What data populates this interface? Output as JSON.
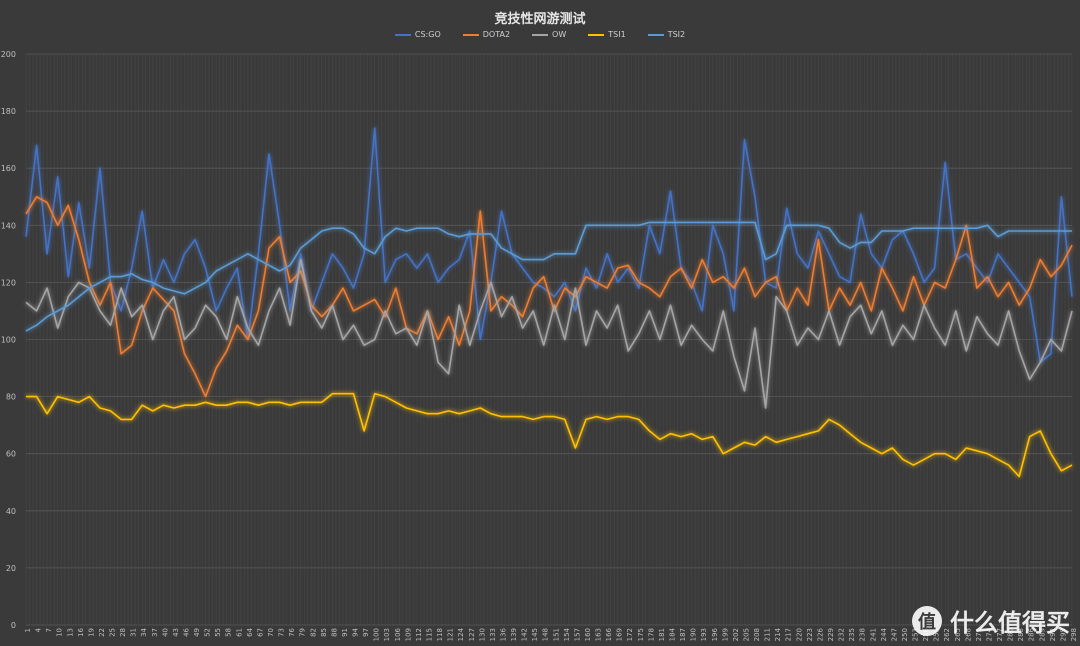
{
  "chart_data": {
    "type": "line",
    "title": "竞技性网游测试",
    "xlabel": "",
    "ylabel": "",
    "ylim": [
      0,
      200
    ],
    "yticks": [
      0,
      20,
      40,
      60,
      80,
      100,
      120,
      140,
      160,
      180,
      200
    ],
    "x_tick_labels": [
      1,
      4,
      7,
      10,
      13,
      16,
      19,
      22,
      25,
      28,
      31,
      34,
      37,
      40,
      43,
      46,
      49,
      52,
      55,
      58,
      61,
      64,
      67,
      70,
      73,
      76,
      79,
      82,
      85,
      88,
      91,
      94,
      97,
      100,
      103,
      106,
      109,
      112,
      115,
      118,
      121,
      124,
      127,
      130,
      133,
      136,
      139,
      142,
      145,
      148,
      151,
      154,
      157,
      160,
      163,
      166,
      169,
      172,
      175,
      178,
      181,
      184,
      187,
      190,
      193,
      196,
      199,
      202,
      205,
      208,
      211,
      214,
      217,
      220,
      223,
      226,
      229,
      232,
      235,
      238,
      241,
      244,
      247,
      250,
      253,
      256,
      259,
      262,
      265,
      268,
      271,
      274,
      277,
      280,
      283,
      286,
      289,
      292,
      295,
      298
    ],
    "grid": true,
    "legend_position": "top",
    "series": [
      {
        "name": "CS:GO",
        "color": "#4472c4",
        "x": [
          1,
          4,
          7,
          10,
          13,
          16,
          19,
          22,
          25,
          28,
          31,
          34,
          37,
          40,
          43,
          46,
          49,
          52,
          55,
          58,
          61,
          64,
          67,
          70,
          73,
          76,
          79,
          82,
          85,
          88,
          91,
          94,
          97,
          100,
          103,
          106,
          109,
          112,
          115,
          118,
          121,
          124,
          127,
          130,
          133,
          136,
          139,
          142,
          145,
          148,
          151,
          154,
          157,
          160,
          163,
          166,
          169,
          172,
          175,
          178,
          181,
          184,
          187,
          190,
          193,
          196,
          199,
          202,
          205,
          208,
          211,
          214,
          217,
          220,
          223,
          226,
          229,
          232,
          235,
          238,
          241,
          244,
          247,
          250,
          253,
          256,
          259,
          262,
          265,
          268,
          271,
          274,
          277,
          280,
          283,
          286,
          289,
          292,
          295,
          298
        ],
        "values": [
          136,
          168,
          130,
          157,
          122,
          148,
          125,
          160,
          120,
          110,
          125,
          145,
          118,
          128,
          120,
          130,
          135,
          125,
          110,
          118,
          125,
          100,
          130,
          165,
          140,
          110,
          130,
          110,
          120,
          130,
          125,
          118,
          130,
          174,
          120,
          128,
          130,
          125,
          130,
          120,
          125,
          128,
          138,
          100,
          120,
          145,
          130,
          125,
          120,
          118,
          115,
          120,
          110,
          125,
          118,
          130,
          120,
          125,
          118,
          140,
          130,
          152,
          125,
          120,
          110,
          140,
          130,
          110,
          170,
          150,
          120,
          118,
          146,
          130,
          125,
          138,
          130,
          122,
          120,
          144,
          130,
          125,
          135,
          138,
          130,
          120,
          125,
          162,
          128,
          130,
          125,
          120,
          130,
          125,
          120,
          115,
          92,
          95,
          150,
          115
        ]
      },
      {
        "name": "DOTA2",
        "color": "#ed7d31",
        "x": [
          1,
          4,
          7,
          10,
          13,
          16,
          19,
          22,
          25,
          28,
          31,
          34,
          37,
          40,
          43,
          46,
          49,
          52,
          55,
          58,
          61,
          64,
          67,
          70,
          73,
          76,
          79,
          82,
          85,
          88,
          91,
          94,
          97,
          100,
          103,
          106,
          109,
          112,
          115,
          118,
          121,
          124,
          127,
          130,
          133,
          136,
          139,
          142,
          145,
          148,
          151,
          154,
          157,
          160,
          163,
          166,
          169,
          172,
          175,
          178,
          181,
          184,
          187,
          190,
          193,
          196,
          199,
          202,
          205,
          208,
          211,
          214,
          217,
          220,
          223,
          226,
          229,
          232,
          235,
          238,
          241,
          244,
          247,
          250,
          253,
          256,
          259,
          262,
          265,
          268,
          271,
          274,
          277,
          280,
          283,
          286,
          289,
          292,
          295,
          298
        ],
        "values": [
          144,
          150,
          148,
          140,
          147,
          135,
          120,
          112,
          120,
          95,
          98,
          110,
          118,
          114,
          110,
          95,
          88,
          80,
          90,
          96,
          105,
          100,
          110,
          132,
          136,
          120,
          124,
          112,
          108,
          112,
          118,
          110,
          112,
          114,
          108,
          118,
          104,
          102,
          110,
          100,
          108,
          98,
          110,
          145,
          110,
          115,
          112,
          108,
          118,
          122,
          110,
          118,
          115,
          122,
          120,
          118,
          125,
          126,
          120,
          118,
          115,
          122,
          125,
          118,
          128,
          120,
          122,
          118,
          125,
          115,
          120,
          122,
          110,
          118,
          112,
          135,
          110,
          118,
          112,
          120,
          110,
          125,
          118,
          110,
          122,
          112,
          120,
          118,
          128,
          140,
          118,
          122,
          115,
          120,
          112,
          118,
          128,
          122,
          126,
          133
        ]
      },
      {
        "name": "OW",
        "color": "#a5a5a5",
        "x": [
          1,
          4,
          7,
          10,
          13,
          16,
          19,
          22,
          25,
          28,
          31,
          34,
          37,
          40,
          43,
          46,
          49,
          52,
          55,
          58,
          61,
          64,
          67,
          70,
          73,
          76,
          79,
          82,
          85,
          88,
          91,
          94,
          97,
          100,
          103,
          106,
          109,
          112,
          115,
          118,
          121,
          124,
          127,
          130,
          133,
          136,
          139,
          142,
          145,
          148,
          151,
          154,
          157,
          160,
          163,
          166,
          169,
          172,
          175,
          178,
          181,
          184,
          187,
          190,
          193,
          196,
          199,
          202,
          205,
          208,
          211,
          214,
          217,
          220,
          223,
          226,
          229,
          232,
          235,
          238,
          241,
          244,
          247,
          250,
          253,
          256,
          259,
          262,
          265,
          268,
          271,
          274,
          277,
          280,
          283,
          286,
          289,
          292,
          295,
          298
        ],
        "values": [
          113,
          110,
          118,
          104,
          115,
          120,
          118,
          110,
          105,
          118,
          108,
          112,
          100,
          110,
          115,
          100,
          104,
          112,
          108,
          100,
          115,
          104,
          98,
          110,
          118,
          105,
          128,
          110,
          104,
          112,
          100,
          105,
          98,
          100,
          110,
          102,
          104,
          98,
          110,
          92,
          88,
          112,
          98,
          110,
          120,
          108,
          115,
          104,
          110,
          98,
          112,
          100,
          118,
          98,
          110,
          104,
          112,
          96,
          102,
          110,
          100,
          112,
          98,
          105,
          100,
          96,
          110,
          94,
          82,
          104,
          76,
          115,
          110,
          98,
          104,
          100,
          110,
          98,
          108,
          112,
          102,
          110,
          98,
          105,
          100,
          112,
          104,
          98,
          110,
          96,
          108,
          102,
          98,
          110,
          96,
          86,
          92,
          100,
          96,
          110
        ]
      },
      {
        "name": "TSI1",
        "color": "#ffc000",
        "x": [
          1,
          4,
          7,
          10,
          13,
          16,
          19,
          22,
          25,
          28,
          31,
          34,
          37,
          40,
          43,
          46,
          49,
          52,
          55,
          58,
          61,
          64,
          67,
          70,
          73,
          76,
          79,
          82,
          85,
          88,
          91,
          94,
          97,
          100,
          103,
          106,
          109,
          112,
          115,
          118,
          121,
          124,
          127,
          130,
          133,
          136,
          139,
          142,
          145,
          148,
          151,
          154,
          157,
          160,
          163,
          166,
          169,
          172,
          175,
          178,
          181,
          184,
          187,
          190,
          193,
          196,
          199,
          202,
          205,
          208,
          211,
          214,
          217,
          220,
          223,
          226,
          229,
          232,
          235,
          238,
          241,
          244,
          247,
          250,
          253,
          256,
          259,
          262,
          265,
          268,
          271,
          274,
          277,
          280,
          283,
          286,
          289,
          292,
          295,
          298
        ],
        "values": [
          80,
          80,
          74,
          80,
          79,
          78,
          80,
          76,
          75,
          72,
          72,
          77,
          75,
          77,
          76,
          77,
          77,
          78,
          77,
          77,
          78,
          78,
          77,
          78,
          78,
          77,
          78,
          78,
          78,
          81,
          81,
          81,
          68,
          81,
          80,
          78,
          76,
          75,
          74,
          74,
          75,
          74,
          75,
          76,
          74,
          73,
          73,
          73,
          72,
          73,
          73,
          72,
          62,
          72,
          73,
          72,
          73,
          73,
          72,
          68,
          65,
          67,
          66,
          67,
          65,
          66,
          60,
          62,
          64,
          63,
          66,
          64,
          65,
          66,
          67,
          68,
          72,
          70,
          67,
          64,
          62,
          60,
          62,
          58,
          56,
          58,
          60,
          60,
          58,
          62,
          61,
          60,
          58,
          56,
          52,
          66,
          68,
          60,
          54,
          56
        ]
      },
      {
        "name": "TSI2",
        "color": "#5b9bd5",
        "x": [
          1,
          4,
          7,
          10,
          13,
          16,
          19,
          22,
          25,
          28,
          31,
          34,
          37,
          40,
          43,
          46,
          49,
          52,
          55,
          58,
          61,
          64,
          67,
          70,
          73,
          76,
          79,
          82,
          85,
          88,
          91,
          94,
          97,
          100,
          103,
          106,
          109,
          112,
          115,
          118,
          121,
          124,
          127,
          130,
          133,
          136,
          139,
          142,
          145,
          148,
          151,
          154,
          157,
          160,
          163,
          166,
          169,
          172,
          175,
          178,
          181,
          184,
          187,
          190,
          193,
          196,
          199,
          202,
          205,
          208,
          211,
          214,
          217,
          220,
          223,
          226,
          229,
          232,
          235,
          238,
          241,
          244,
          247,
          250,
          253,
          256,
          259,
          262,
          265,
          268,
          271,
          274,
          277,
          280,
          283,
          286,
          289,
          292,
          295,
          298
        ],
        "values": [
          103,
          105,
          108,
          110,
          112,
          115,
          118,
          120,
          122,
          122,
          123,
          121,
          120,
          118,
          117,
          116,
          118,
          120,
          124,
          126,
          128,
          130,
          128,
          126,
          124,
          126,
          132,
          135,
          138,
          139,
          139,
          137,
          132,
          130,
          136,
          139,
          138,
          139,
          139,
          139,
          137,
          136,
          137,
          137,
          137,
          132,
          130,
          128,
          128,
          128,
          130,
          130,
          130,
          140,
          140,
          140,
          140,
          140,
          140,
          141,
          141,
          141,
          141,
          141,
          141,
          141,
          141,
          141,
          141,
          141,
          128,
          130,
          140,
          140,
          140,
          140,
          139,
          134,
          132,
          134,
          134,
          138,
          138,
          138,
          139,
          139,
          139,
          139,
          139,
          139,
          139,
          140,
          136,
          138,
          138,
          138,
          138,
          138,
          138,
          138
        ]
      }
    ]
  },
  "watermark": {
    "badge": "值",
    "text": "什么值得买"
  }
}
